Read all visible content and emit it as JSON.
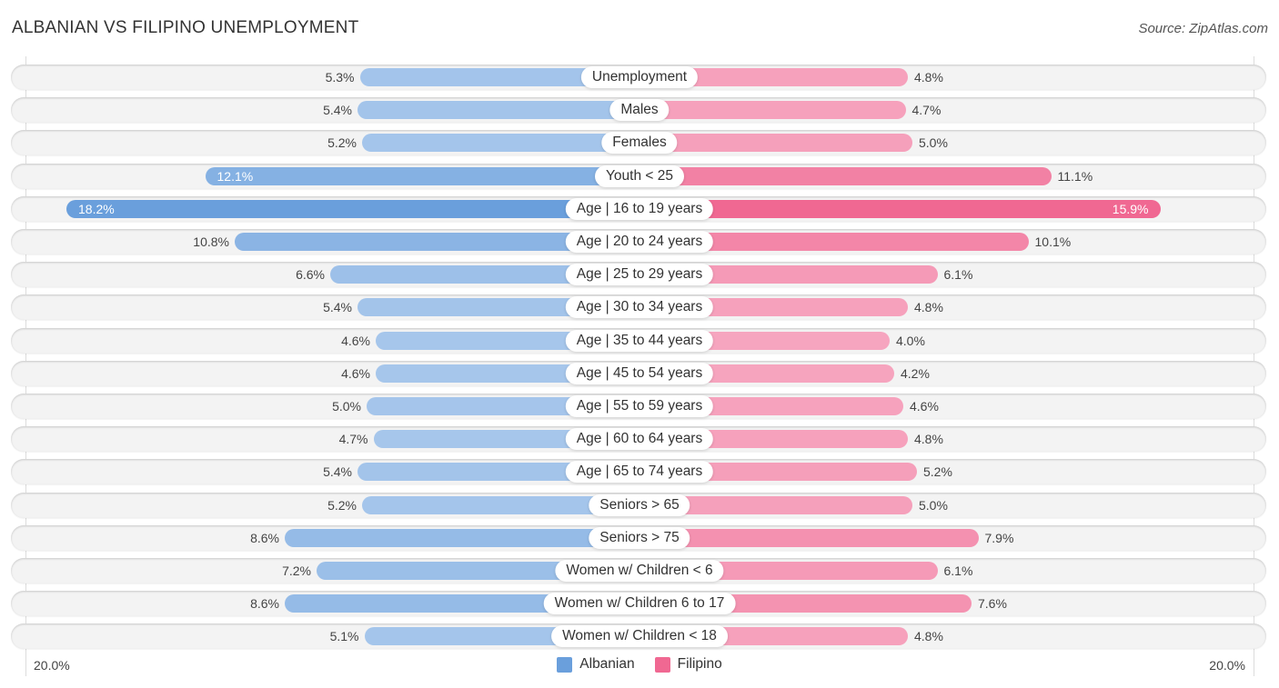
{
  "header": {
    "title": "ALBANIAN VS FILIPINO UNEMPLOYMENT",
    "source": "Source: ZipAtlas.com"
  },
  "colors": {
    "albanian": "#6a9fdc",
    "albanian_light": "#a9c8ec",
    "filipino": "#f06892",
    "filipino_light": "#f6a5bf"
  },
  "chart_data": {
    "type": "bar",
    "orientation": "horizontal-diverging",
    "title": "ALBANIAN VS FILIPINO UNEMPLOYMENT",
    "xlabel": "",
    "ylabel": "",
    "xlim": [
      0,
      20
    ],
    "axis_tick_labels": {
      "left": "20.0%",
      "right": "20.0%"
    },
    "legend_position": "bottom-center",
    "categories": [
      "Unemployment",
      "Males",
      "Females",
      "Youth < 25",
      "Age | 16 to 19 years",
      "Age | 20 to 24 years",
      "Age | 25 to 29 years",
      "Age | 30 to 34 years",
      "Age | 35 to 44 years",
      "Age | 45 to 54 years",
      "Age | 55 to 59 years",
      "Age | 60 to 64 years",
      "Age | 65 to 74 years",
      "Seniors > 65",
      "Seniors > 75",
      "Women w/ Children < 6",
      "Women w/ Children 6 to 17",
      "Women w/ Children < 18"
    ],
    "series": [
      {
        "name": "Albanian",
        "side": "left",
        "values": [
          5.3,
          5.4,
          5.2,
          12.1,
          18.2,
          10.8,
          6.6,
          5.4,
          4.6,
          4.6,
          5.0,
          4.7,
          5.4,
          5.2,
          8.6,
          7.2,
          8.6,
          5.1
        ],
        "labels": [
          "5.3%",
          "5.4%",
          "5.2%",
          "12.1%",
          "18.2%",
          "10.8%",
          "6.6%",
          "5.4%",
          "4.6%",
          "4.6%",
          "5.0%",
          "4.7%",
          "5.4%",
          "5.2%",
          "8.6%",
          "7.2%",
          "8.6%",
          "5.1%"
        ]
      },
      {
        "name": "Filipino",
        "side": "right",
        "values": [
          4.8,
          4.7,
          5.0,
          11.1,
          15.9,
          10.1,
          6.1,
          4.8,
          4.0,
          4.2,
          4.6,
          4.8,
          5.2,
          5.0,
          7.9,
          6.1,
          7.6,
          4.8
        ],
        "labels": [
          "4.8%",
          "4.7%",
          "5.0%",
          "11.1%",
          "15.9%",
          "10.1%",
          "6.1%",
          "4.8%",
          "4.0%",
          "4.2%",
          "4.6%",
          "4.8%",
          "5.2%",
          "5.0%",
          "7.9%",
          "6.1%",
          "7.6%",
          "4.8%"
        ]
      }
    ]
  },
  "legend": [
    {
      "name": "Albanian",
      "color": "#6a9fdc"
    },
    {
      "name": "Filipino",
      "color": "#f06892"
    }
  ]
}
